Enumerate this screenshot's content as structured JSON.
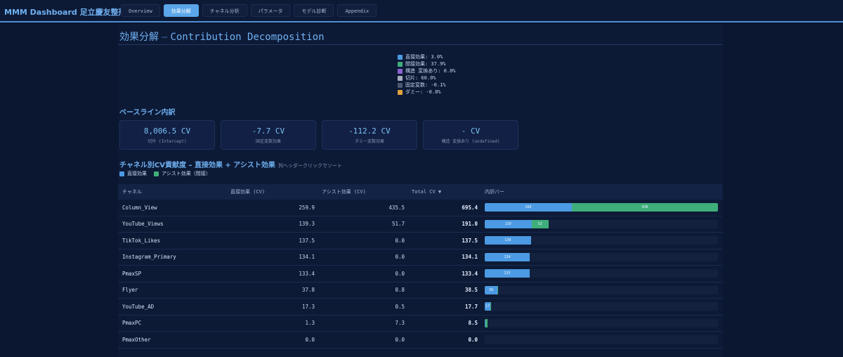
{
  "app": {
    "title": "MMM Dashboard 足立慶友整形外科"
  },
  "tabs": [
    {
      "label": "Overview",
      "active": false
    },
    {
      "label": "効果分解",
      "active": true
    },
    {
      "label": "チャネル分析",
      "active": false
    },
    {
      "label": "パラメータ",
      "active": false
    },
    {
      "label": "モデル診断",
      "active": false
    },
    {
      "label": "Appendix",
      "active": false
    }
  ],
  "section": {
    "title_jp": "効果分解",
    "dash": "–",
    "title_en": "Contribution Decomposition"
  },
  "legend": [
    {
      "label": "直接効果: 3.0%",
      "color": "#4c9ae3"
    },
    {
      "label": "間接効果: 37.9%",
      "color": "#3fae7a"
    },
    {
      "label": "構造 変換あり: 0.0%",
      "color": "#8a63d2"
    },
    {
      "label": "切片: 60.0%",
      "color": "#a6aec0"
    },
    {
      "label": "固定変数: -0.1%",
      "color": "#4d5870"
    },
    {
      "label": "ダミー: -0.8%",
      "color": "#e2a23a"
    }
  ],
  "baseline": {
    "title": "ベースライン内訳",
    "cards": [
      {
        "value": "8,006.5 CV",
        "label": "切片 (Intercept)"
      },
      {
        "value": "-7.7 CV",
        "label": "固定変数効果"
      },
      {
        "value": "-112.2 CV",
        "label": "ダミー変数効果"
      },
      {
        "value": "- CV",
        "label": "構造 変換あり (undefined)"
      }
    ]
  },
  "channel_section": {
    "title": "チャネル別CV貢献度 – 直接効果 + アシスト効果",
    "hint": "列ヘッダークリックでソート",
    "legend_direct": "直接効果",
    "legend_assist": "アシスト効果（間接）",
    "color_direct": "#4c9ae3",
    "color_assist": "#3fae7a"
  },
  "table": {
    "headers": {
      "channel": "チャネル",
      "direct": "直接効果 (CV)",
      "assist": "アシスト効果 (CV)",
      "total": "Total CV ▼",
      "bar": "内訳バー"
    },
    "max_total": 695.4,
    "rows": [
      {
        "channel": "Column_View",
        "direct": "259.9",
        "assist": "435.5",
        "total": "695.4",
        "direct_v": 259.9,
        "assist_v": 435.5,
        "direct_lbl": "260",
        "assist_lbl": "436"
      },
      {
        "channel": "YouTube_Views",
        "direct": "139.3",
        "assist": "51.7",
        "total": "191.0",
        "direct_v": 139.3,
        "assist_v": 51.7,
        "direct_lbl": "139",
        "assist_lbl": "52"
      },
      {
        "channel": "TikTok_Likes",
        "direct": "137.5",
        "assist": "0.0",
        "total": "137.5",
        "direct_v": 137.5,
        "assist_v": 0,
        "direct_lbl": "138",
        "assist_lbl": ""
      },
      {
        "channel": "Instagram_Primary",
        "direct": "134.1",
        "assist": "0.0",
        "total": "134.1",
        "direct_v": 134.1,
        "assist_v": 0,
        "direct_lbl": "134",
        "assist_lbl": ""
      },
      {
        "channel": "PmaxSP",
        "direct": "133.4",
        "assist": "0.0",
        "total": "133.4",
        "direct_v": 133.4,
        "assist_v": 0,
        "direct_lbl": "133",
        "assist_lbl": ""
      },
      {
        "channel": "Flyer",
        "direct": "37.8",
        "assist": "0.8",
        "total": "38.5",
        "direct_v": 37.8,
        "assist_v": 0.8,
        "direct_lbl": "38",
        "assist_lbl": ""
      },
      {
        "channel": "YouTube_AD",
        "direct": "17.3",
        "assist": "0.5",
        "total": "17.7",
        "direct_v": 17.3,
        "assist_v": 0.5,
        "direct_lbl": "17",
        "assist_lbl": ""
      },
      {
        "channel": "PmaxPC",
        "direct": "1.3",
        "assist": "7.3",
        "total": "8.5",
        "direct_v": 1.3,
        "assist_v": 7.3,
        "direct_lbl": "",
        "assist_lbl": ""
      },
      {
        "channel": "PmaxOther",
        "direct": "0.0",
        "assist": "0.0",
        "total": "0.0",
        "direct_v": 0,
        "assist_v": 0,
        "direct_lbl": "",
        "assist_lbl": ""
      }
    ]
  }
}
